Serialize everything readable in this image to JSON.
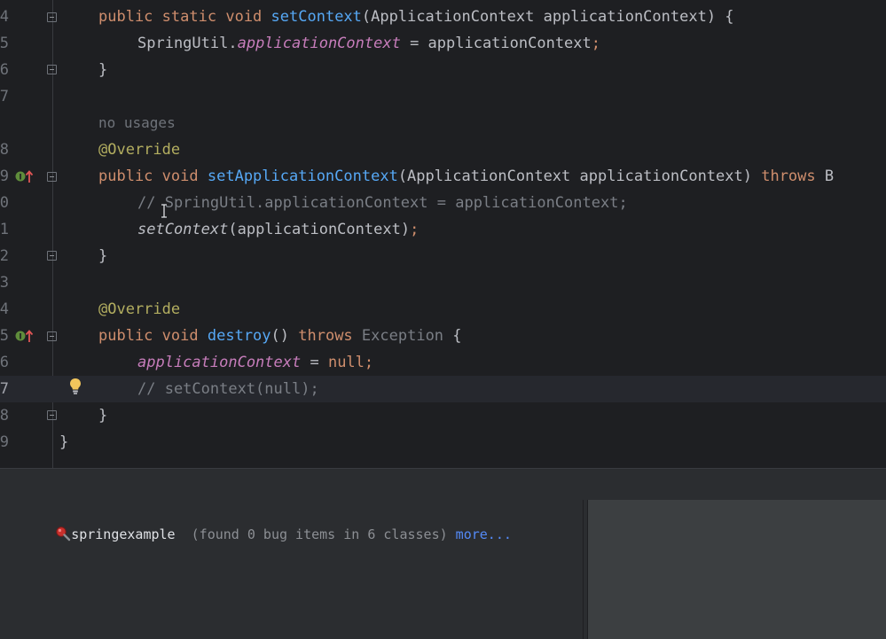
{
  "editor": {
    "lines": {
      "l14": {
        "num": "4"
      },
      "l15": {
        "num": "5"
      },
      "l16": {
        "num": "6"
      },
      "l17": {
        "num": "7"
      },
      "l18": {
        "num": "8"
      },
      "l19": {
        "num": "9"
      },
      "l20": {
        "num": "0"
      },
      "l21": {
        "num": "1"
      },
      "l22": {
        "num": "2"
      },
      "l23": {
        "num": "3"
      },
      "l24": {
        "num": "4"
      },
      "l25": {
        "num": "5"
      },
      "l26": {
        "num": "6"
      },
      "l27": {
        "num": "7"
      },
      "l28": {
        "num": "8"
      },
      "l29": {
        "num": "9"
      }
    },
    "tokens": {
      "public": "public",
      "static": "static",
      "void": "void",
      "throws": "throws",
      "null": "null",
      "setContext": "setContext",
      "setApplicationContext": "setApplicationContext",
      "destroy": "destroy",
      "params_setContext": "(ApplicationContext applicationContext) {",
      "params_setAppCtx": "(ApplicationContext applicationContext) ",
      "b_trunc": "B",
      "springutil": "SpringUtil.",
      "applicationContext_field": "applicationContext",
      "assign": " = applicationContext",
      "semi": ";",
      "close_brace": "}",
      "no_usages": "no usages",
      "override": "@Override",
      "comment_springutil": "// SpringUtil.applicationContext = applicationContext;",
      "call_args": "(applicationContext)",
      "destroy_parens": "() ",
      "exception": "Exception",
      "open_brace": " {",
      "eq": " = ",
      "comment_setcontext": "// setContext(null);"
    }
  },
  "findbugs": {
    "project": "springexample",
    "found_text": "(found 0 bug items in 6 classes)",
    "more_link": "more...",
    "icon": "findbugs-bug-icon"
  },
  "colors": {
    "editor_bg": "#1e1f22",
    "keyword": "#cf8e6d",
    "method": "#56a8f5",
    "field": "#c77dbb",
    "annotation": "#b3ae60",
    "comment": "#7a7e85",
    "link": "#548af7"
  }
}
